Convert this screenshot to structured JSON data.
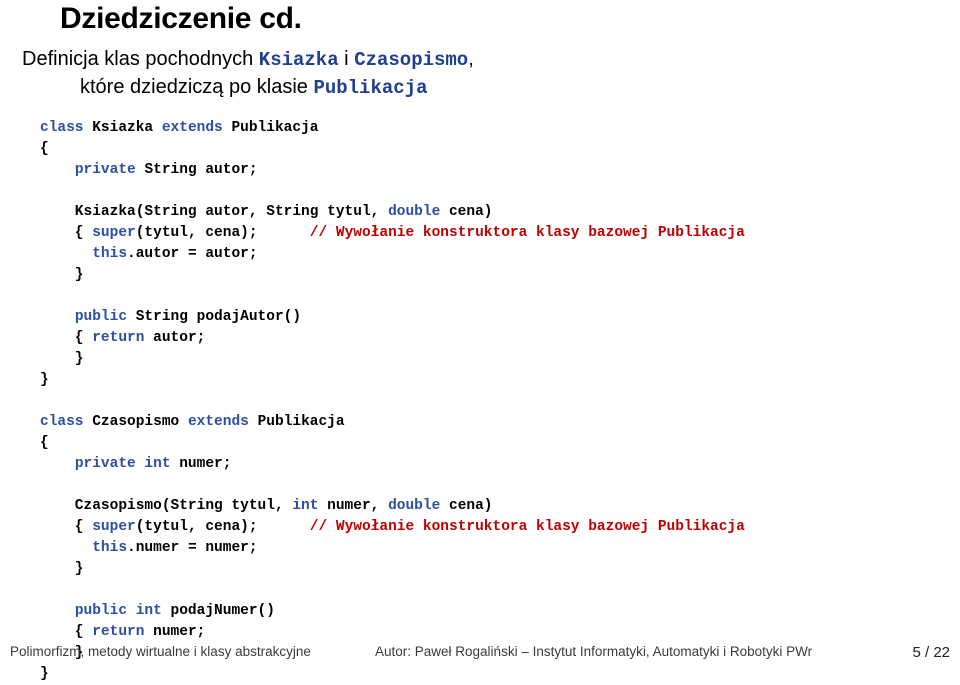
{
  "slide": {
    "title": "Dziedziczenie cd.",
    "subtitle_prefix": "Definicja klas pochodnych ",
    "subtitle_class_a": "Ksiazka",
    "subtitle_conj": " i ",
    "subtitle_class_b": "Czasopismo",
    "subtitle_comma": ",",
    "subtitle_line2_prefix": "które dziedziczą po klasie ",
    "subtitle_line2_class": "Publikacja",
    "code_lines": [
      {
        "segments": [
          {
            "t": "class ",
            "s": "kw"
          },
          {
            "t": "Ksiazka ",
            "s": "pl"
          },
          {
            "t": "extends ",
            "s": "kw"
          },
          {
            "t": "Publikacja",
            "s": "pl"
          }
        ]
      },
      {
        "segments": [
          {
            "t": "{",
            "s": "pl"
          }
        ]
      },
      {
        "segments": [
          {
            "t": "    ",
            "s": "pl"
          },
          {
            "t": "private ",
            "s": "kw"
          },
          {
            "t": "String autor;",
            "s": "pl"
          }
        ]
      },
      {
        "segments": [
          {
            "t": "",
            "s": "pl"
          }
        ]
      },
      {
        "segments": [
          {
            "t": "    Ksiazka(String autor, String tytul, ",
            "s": "pl"
          },
          {
            "t": "double",
            "s": "kw"
          },
          {
            "t": " cena)",
            "s": "pl"
          }
        ]
      },
      {
        "segments": [
          {
            "t": "    { ",
            "s": "pl"
          },
          {
            "t": "super",
            "s": "kw"
          },
          {
            "t": "(tytul, cena);      ",
            "s": "pl"
          },
          {
            "t": "// Wywołanie konstruktora klasy bazowej Publikacja",
            "s": "cm"
          }
        ]
      },
      {
        "segments": [
          {
            "t": "      ",
            "s": "pl"
          },
          {
            "t": "this",
            "s": "kw"
          },
          {
            "t": ".autor = autor;",
            "s": "pl"
          }
        ]
      },
      {
        "segments": [
          {
            "t": "    }",
            "s": "pl"
          }
        ]
      },
      {
        "segments": [
          {
            "t": "",
            "s": "pl"
          }
        ]
      },
      {
        "segments": [
          {
            "t": "    ",
            "s": "pl"
          },
          {
            "t": "public ",
            "s": "kw"
          },
          {
            "t": "String podajAutor()",
            "s": "pl"
          }
        ]
      },
      {
        "segments": [
          {
            "t": "    { ",
            "s": "pl"
          },
          {
            "t": "return ",
            "s": "kw"
          },
          {
            "t": "autor;",
            "s": "pl"
          }
        ]
      },
      {
        "segments": [
          {
            "t": "    }",
            "s": "pl"
          }
        ]
      },
      {
        "segments": [
          {
            "t": "}",
            "s": "pl"
          }
        ]
      },
      {
        "segments": [
          {
            "t": "",
            "s": "pl"
          }
        ]
      },
      {
        "segments": [
          {
            "t": "class ",
            "s": "kw"
          },
          {
            "t": "Czasopismo ",
            "s": "pl"
          },
          {
            "t": "extends ",
            "s": "kw"
          },
          {
            "t": "Publikacja",
            "s": "pl"
          }
        ]
      },
      {
        "segments": [
          {
            "t": "{",
            "s": "pl"
          }
        ]
      },
      {
        "segments": [
          {
            "t": "    ",
            "s": "pl"
          },
          {
            "t": "private int ",
            "s": "kw"
          },
          {
            "t": "numer;",
            "s": "pl"
          }
        ]
      },
      {
        "segments": [
          {
            "t": "",
            "s": "pl"
          }
        ]
      },
      {
        "segments": [
          {
            "t": "    Czasopismo(String tytul, ",
            "s": "pl"
          },
          {
            "t": "int",
            "s": "kw"
          },
          {
            "t": " numer, ",
            "s": "pl"
          },
          {
            "t": "double",
            "s": "kw"
          },
          {
            "t": " cena)",
            "s": "pl"
          }
        ]
      },
      {
        "segments": [
          {
            "t": "    { ",
            "s": "pl"
          },
          {
            "t": "super",
            "s": "kw"
          },
          {
            "t": "(tytul, cena);      ",
            "s": "pl"
          },
          {
            "t": "// Wywołanie konstruktora klasy bazowej Publikacja",
            "s": "cm"
          }
        ]
      },
      {
        "segments": [
          {
            "t": "      ",
            "s": "pl"
          },
          {
            "t": "this",
            "s": "kw"
          },
          {
            "t": ".numer = numer;",
            "s": "pl"
          }
        ]
      },
      {
        "segments": [
          {
            "t": "    }",
            "s": "pl"
          }
        ]
      },
      {
        "segments": [
          {
            "t": "",
            "s": "pl"
          }
        ]
      },
      {
        "segments": [
          {
            "t": "    ",
            "s": "pl"
          },
          {
            "t": "public int ",
            "s": "kw"
          },
          {
            "t": "podajNumer()",
            "s": "pl"
          }
        ]
      },
      {
        "segments": [
          {
            "t": "    { ",
            "s": "pl"
          },
          {
            "t": "return ",
            "s": "kw"
          },
          {
            "t": "numer;",
            "s": "pl"
          }
        ]
      },
      {
        "segments": [
          {
            "t": "    }",
            "s": "pl"
          }
        ]
      },
      {
        "segments": [
          {
            "t": "}",
            "s": "pl"
          }
        ]
      }
    ]
  },
  "footer": {
    "left": "Polimorfizm, metody wirtualne i klasy abstrakcyjne",
    "center": "Autor: Paweł Rogaliński – Instytut Informatyki, Automatyki i Robotyki PWr",
    "page": "5 / 22"
  }
}
